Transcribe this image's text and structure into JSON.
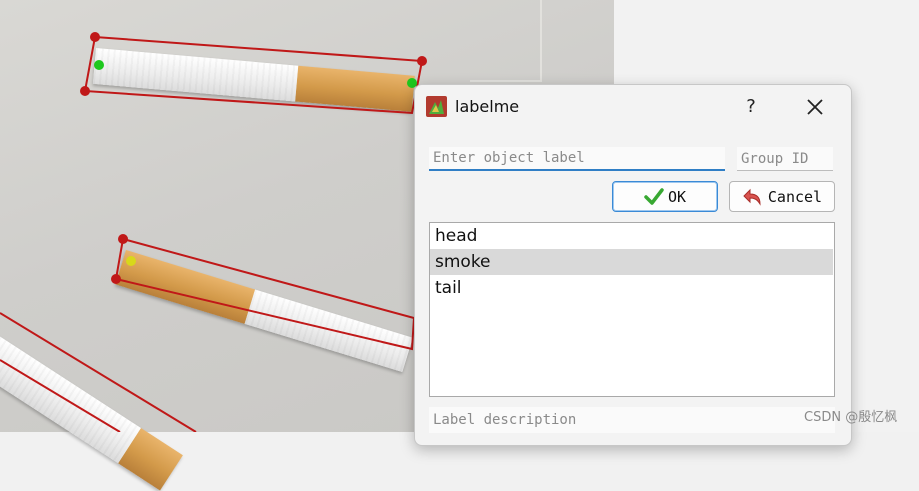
{
  "dialog": {
    "title": "labelme",
    "help_label": "?",
    "label_placeholder": "Enter object label",
    "label_value": "",
    "group_placeholder": "Group ID",
    "ok_label": "OK",
    "cancel_label": "Cancel",
    "labels": [
      "head",
      "smoke",
      "tail"
    ],
    "selected_label": "smoke",
    "description_placeholder": "Label description"
  },
  "colors": {
    "bbox": "#c01818",
    "accent": "#2f7ec5",
    "selected_row": "#d9d9d9"
  },
  "icons": {
    "app": "labelme-icon",
    "ok": "checkmark-icon",
    "cancel": "undo-arrow-icon",
    "close": "close-icon"
  },
  "watermark": "CSDN @殷忆枫"
}
